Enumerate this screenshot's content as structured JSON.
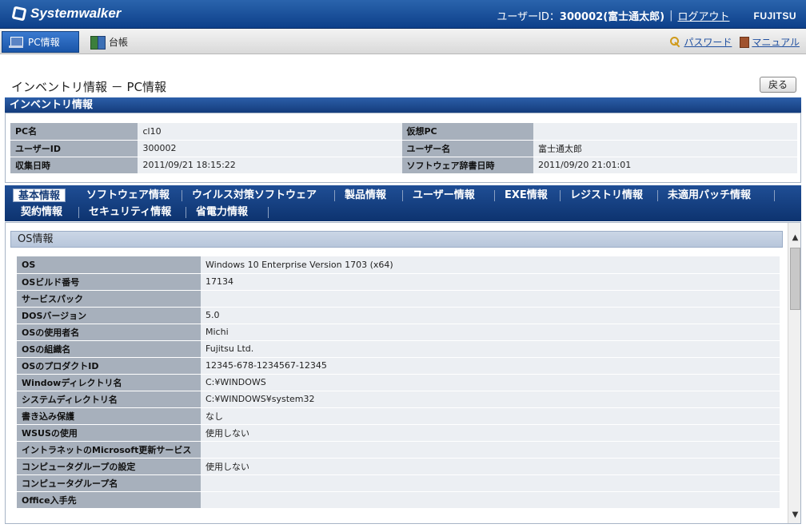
{
  "header": {
    "logo": "Systemwalker",
    "user_label": "ユーザーID：",
    "user_value": "300002(富士通太郎)",
    "separator": "|",
    "logout": "ログアウト",
    "vendor": "FUJITSU"
  },
  "nav": {
    "tabs": [
      {
        "label": "PC情報",
        "icon": "pc-icon",
        "active": true
      },
      {
        "label": "台帳",
        "icon": "ledger-icon",
        "active": false
      }
    ],
    "password": "パスワード",
    "manual": "マニュアル"
  },
  "page": {
    "title": "インベントリ情報 － PC情報",
    "back": "戻る"
  },
  "inventory": {
    "heading": "インベントリ情報",
    "rows": [
      {
        "k1": "PC名",
        "v1": "cl10",
        "k2": "仮想PC",
        "v2": ""
      },
      {
        "k1": "ユーザーID",
        "v1": "300002",
        "k2": "ユーザー名",
        "v2": "富士通太郎"
      },
      {
        "k1": "収集日時",
        "v1": "2011/09/21 18:15:22",
        "k2": "ソフトウェア辞書日時",
        "v2": "2011/09/20 21:01:01"
      }
    ]
  },
  "tabs": {
    "row1": [
      "基本情報",
      "ソフトウェア情報",
      "ウイルス対策ソフトウェア",
      "製品情報",
      "ユーザー情報",
      "EXE情報",
      "レジストリ情報",
      "未適用パッチ情報"
    ],
    "row2": [
      "契約情報",
      "セキュリティ情報",
      "省電力情報"
    ]
  },
  "os": {
    "heading": "OS情報",
    "rows": [
      {
        "k": "OS",
        "v": "Windows 10 Enterprise Version 1703 (x64)"
      },
      {
        "k": "OSビルド番号",
        "v": "17134"
      },
      {
        "k": "サービスパック",
        "v": ""
      },
      {
        "k": "DOSバージョン",
        "v": "5.0"
      },
      {
        "k": "OSの使用者名",
        "v": "Michi"
      },
      {
        "k": "OSの組織名",
        "v": "Fujitsu Ltd."
      },
      {
        "k": "OSのプロダクトID",
        "v": "12345-678-1234567-12345"
      },
      {
        "k": "Windowディレクトリ名",
        "v": "C:¥WINDOWS"
      },
      {
        "k": "システムディレクトリ名",
        "v": "C:¥WINDOWS¥system32"
      },
      {
        "k": "書き込み保護",
        "v": "なし"
      },
      {
        "k": "WSUSの使用",
        "v": "使用しない"
      },
      {
        "k": "イントラネットのMicrosoft更新サービス",
        "v": ""
      },
      {
        "k": "コンピュータグループの設定",
        "v": "使用しない"
      },
      {
        "k": "コンピュータグループ名",
        "v": ""
      },
      {
        "k": "Office入手先",
        "v": ""
      }
    ]
  }
}
